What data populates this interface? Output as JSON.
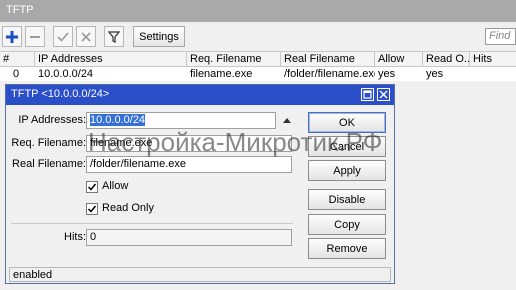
{
  "window": {
    "title": "TFTP"
  },
  "toolbar": {
    "add_icon": "plus-icon",
    "remove_icon": "minus-icon",
    "enable_icon": "checkmark-icon",
    "disable_icon": "cross-icon",
    "filter_icon": "filter-icon",
    "settings_label": "Settings",
    "find_placeholder": "Find"
  },
  "table": {
    "headers": [
      "#",
      "IP Addresses",
      "Req. Filename",
      "Real Filename",
      "Allow",
      "Read O...",
      "Hits"
    ],
    "rows": [
      {
        "num": "0",
        "ip": "10.0.0.0/24",
        "req": "filename.exe",
        "real": "/folder/filename.exe",
        "allow": "yes",
        "read_only": "yes",
        "hits": ""
      }
    ]
  },
  "dialog": {
    "title": "TFTP <10.0.0.0/24>",
    "ip_label": "IP Addresses:",
    "ip_value": "10.0.0.0/24",
    "req_label": "Req. Filename:",
    "req_value": "filename.exe",
    "real_label": "Real Filename:",
    "real_value": "/folder/filename.exe",
    "allow_label": "Allow",
    "allow_checked": true,
    "readonly_label": "Read Only",
    "readonly_checked": true,
    "hits_label": "Hits:",
    "hits_value": "0",
    "buttons": {
      "ok": "OK",
      "cancel": "Cancel",
      "apply": "Apply",
      "disable": "Disable",
      "copy": "Copy",
      "remove": "Remove"
    },
    "status": "enabled"
  },
  "watermark": "Настройка-Микротик.РФ",
  "colors": {
    "title_bar": "#a9a9a9",
    "dialog_title": "#2a4fc8",
    "selection": "#3470d8",
    "add_icon": "#1a4fc0"
  }
}
